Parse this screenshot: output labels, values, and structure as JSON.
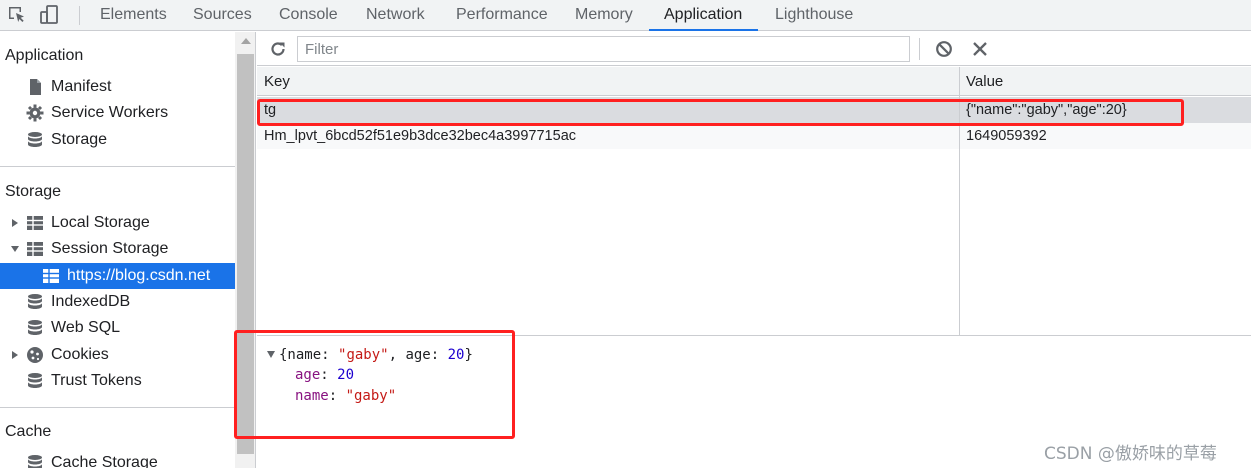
{
  "tabs": [
    "Elements",
    "Sources",
    "Console",
    "Network",
    "Performance",
    "Memory",
    "Application",
    "Lighthouse"
  ],
  "active_tab": "Application",
  "sidebar": {
    "application_header": "Application",
    "application_items": [
      "Manifest",
      "Service Workers",
      "Storage"
    ],
    "storage_header": "Storage",
    "storage_items": [
      "Local Storage",
      "Session Storage",
      "https://blog.csdn.net",
      "IndexedDB",
      "Web SQL",
      "Cookies",
      "Trust Tokens"
    ],
    "cache_header": "Cache",
    "cache_items": [
      "Cache Storage"
    ],
    "selected_item": "https://blog.csdn.net"
  },
  "toolbar": {
    "filter_placeholder": "Filter",
    "icons": [
      "refresh-icon",
      "clear-all-icon",
      "delete-selected-icon"
    ]
  },
  "table": {
    "columns": [
      "Key",
      "Value"
    ],
    "rows": [
      {
        "key": "tg",
        "value": "{\"name\":\"gaby\",\"age\":20}"
      },
      {
        "key": "Hm_lpvt_6bcd52f51e9b3dce32bec4a3997715ac",
        "value": "1649059392"
      }
    ],
    "selected_row": 0
  },
  "preview": {
    "summary_open": "{name: ",
    "summary_name": "\"gaby\"",
    "summary_mid": ", age: ",
    "summary_age": "20",
    "summary_close": "}",
    "age_key": "age",
    "age_value": "20",
    "name_key": "name",
    "name_value": "\"gaby\"",
    "colon": ": "
  },
  "highlight_color": "#ff2020",
  "accent_color": "#1a73e8",
  "watermark": "CSDN @傲娇味的草莓"
}
